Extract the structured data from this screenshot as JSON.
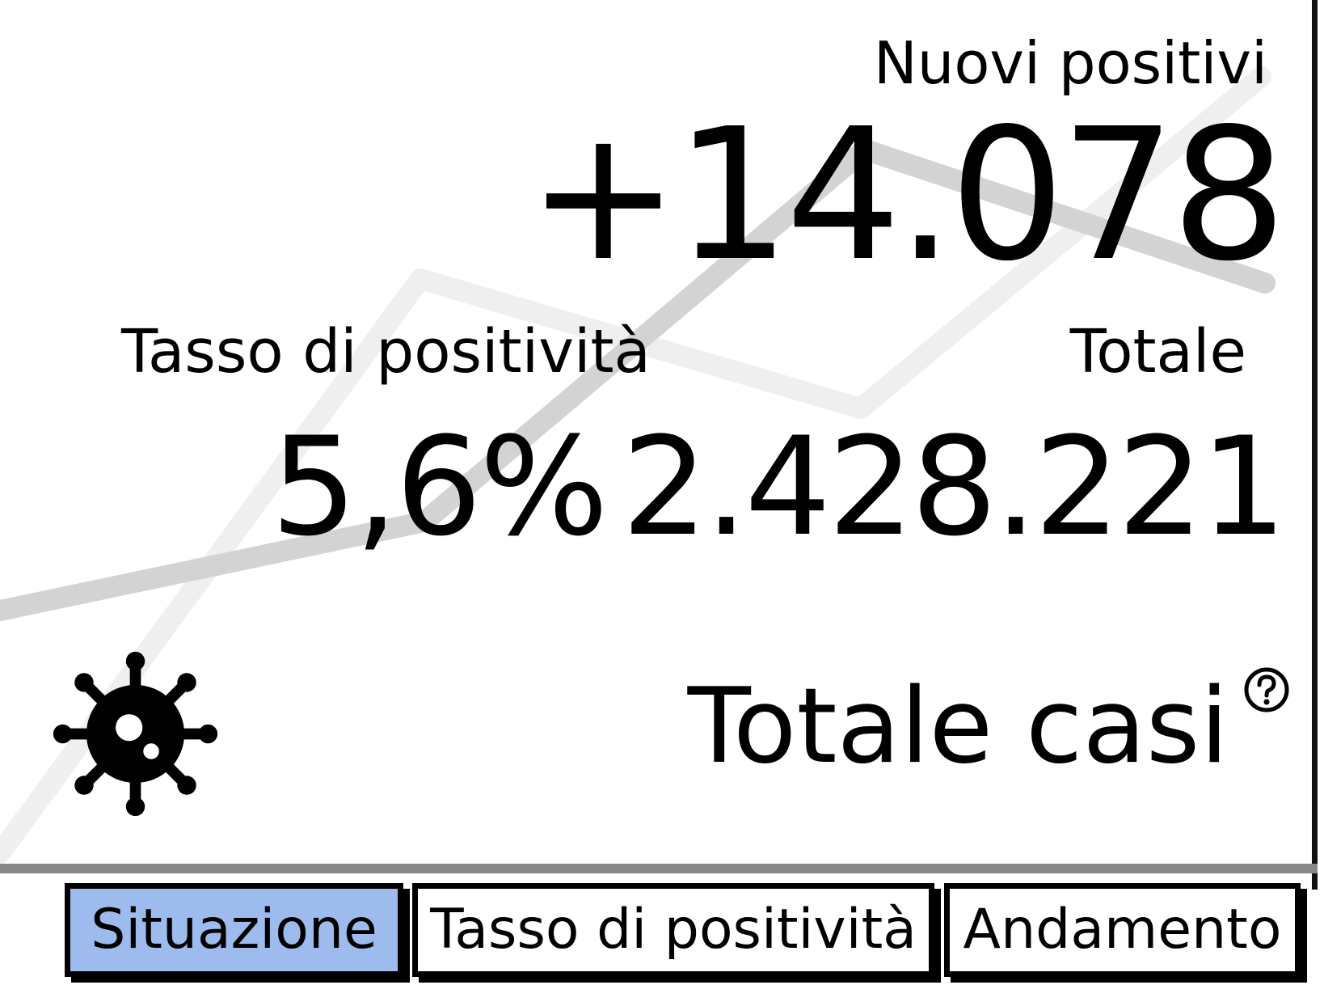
{
  "colors": {
    "background": "#ffffff",
    "text": "#000000",
    "active_tab": "#9dbbed",
    "chart_line_dark": "#d3d3d3",
    "chart_line_light": "#efefef"
  },
  "summary": {
    "new_positive_label": "Nuovi positivi",
    "new_positive_value": "+14.078",
    "positivity_rate_label": "Tasso di positività",
    "positivity_rate_value": "5,6%",
    "total_label": "Totale",
    "total_value": "2.428.221"
  },
  "section": {
    "title": "Totale casi",
    "help_icon": "question-circle-icon",
    "illustration_icon": "virus-icon"
  },
  "tabs": [
    {
      "label": "Situazione",
      "active": true
    },
    {
      "label": "Tasso di positività",
      "active": false
    },
    {
      "label": "Andamento",
      "active": false
    }
  ]
}
